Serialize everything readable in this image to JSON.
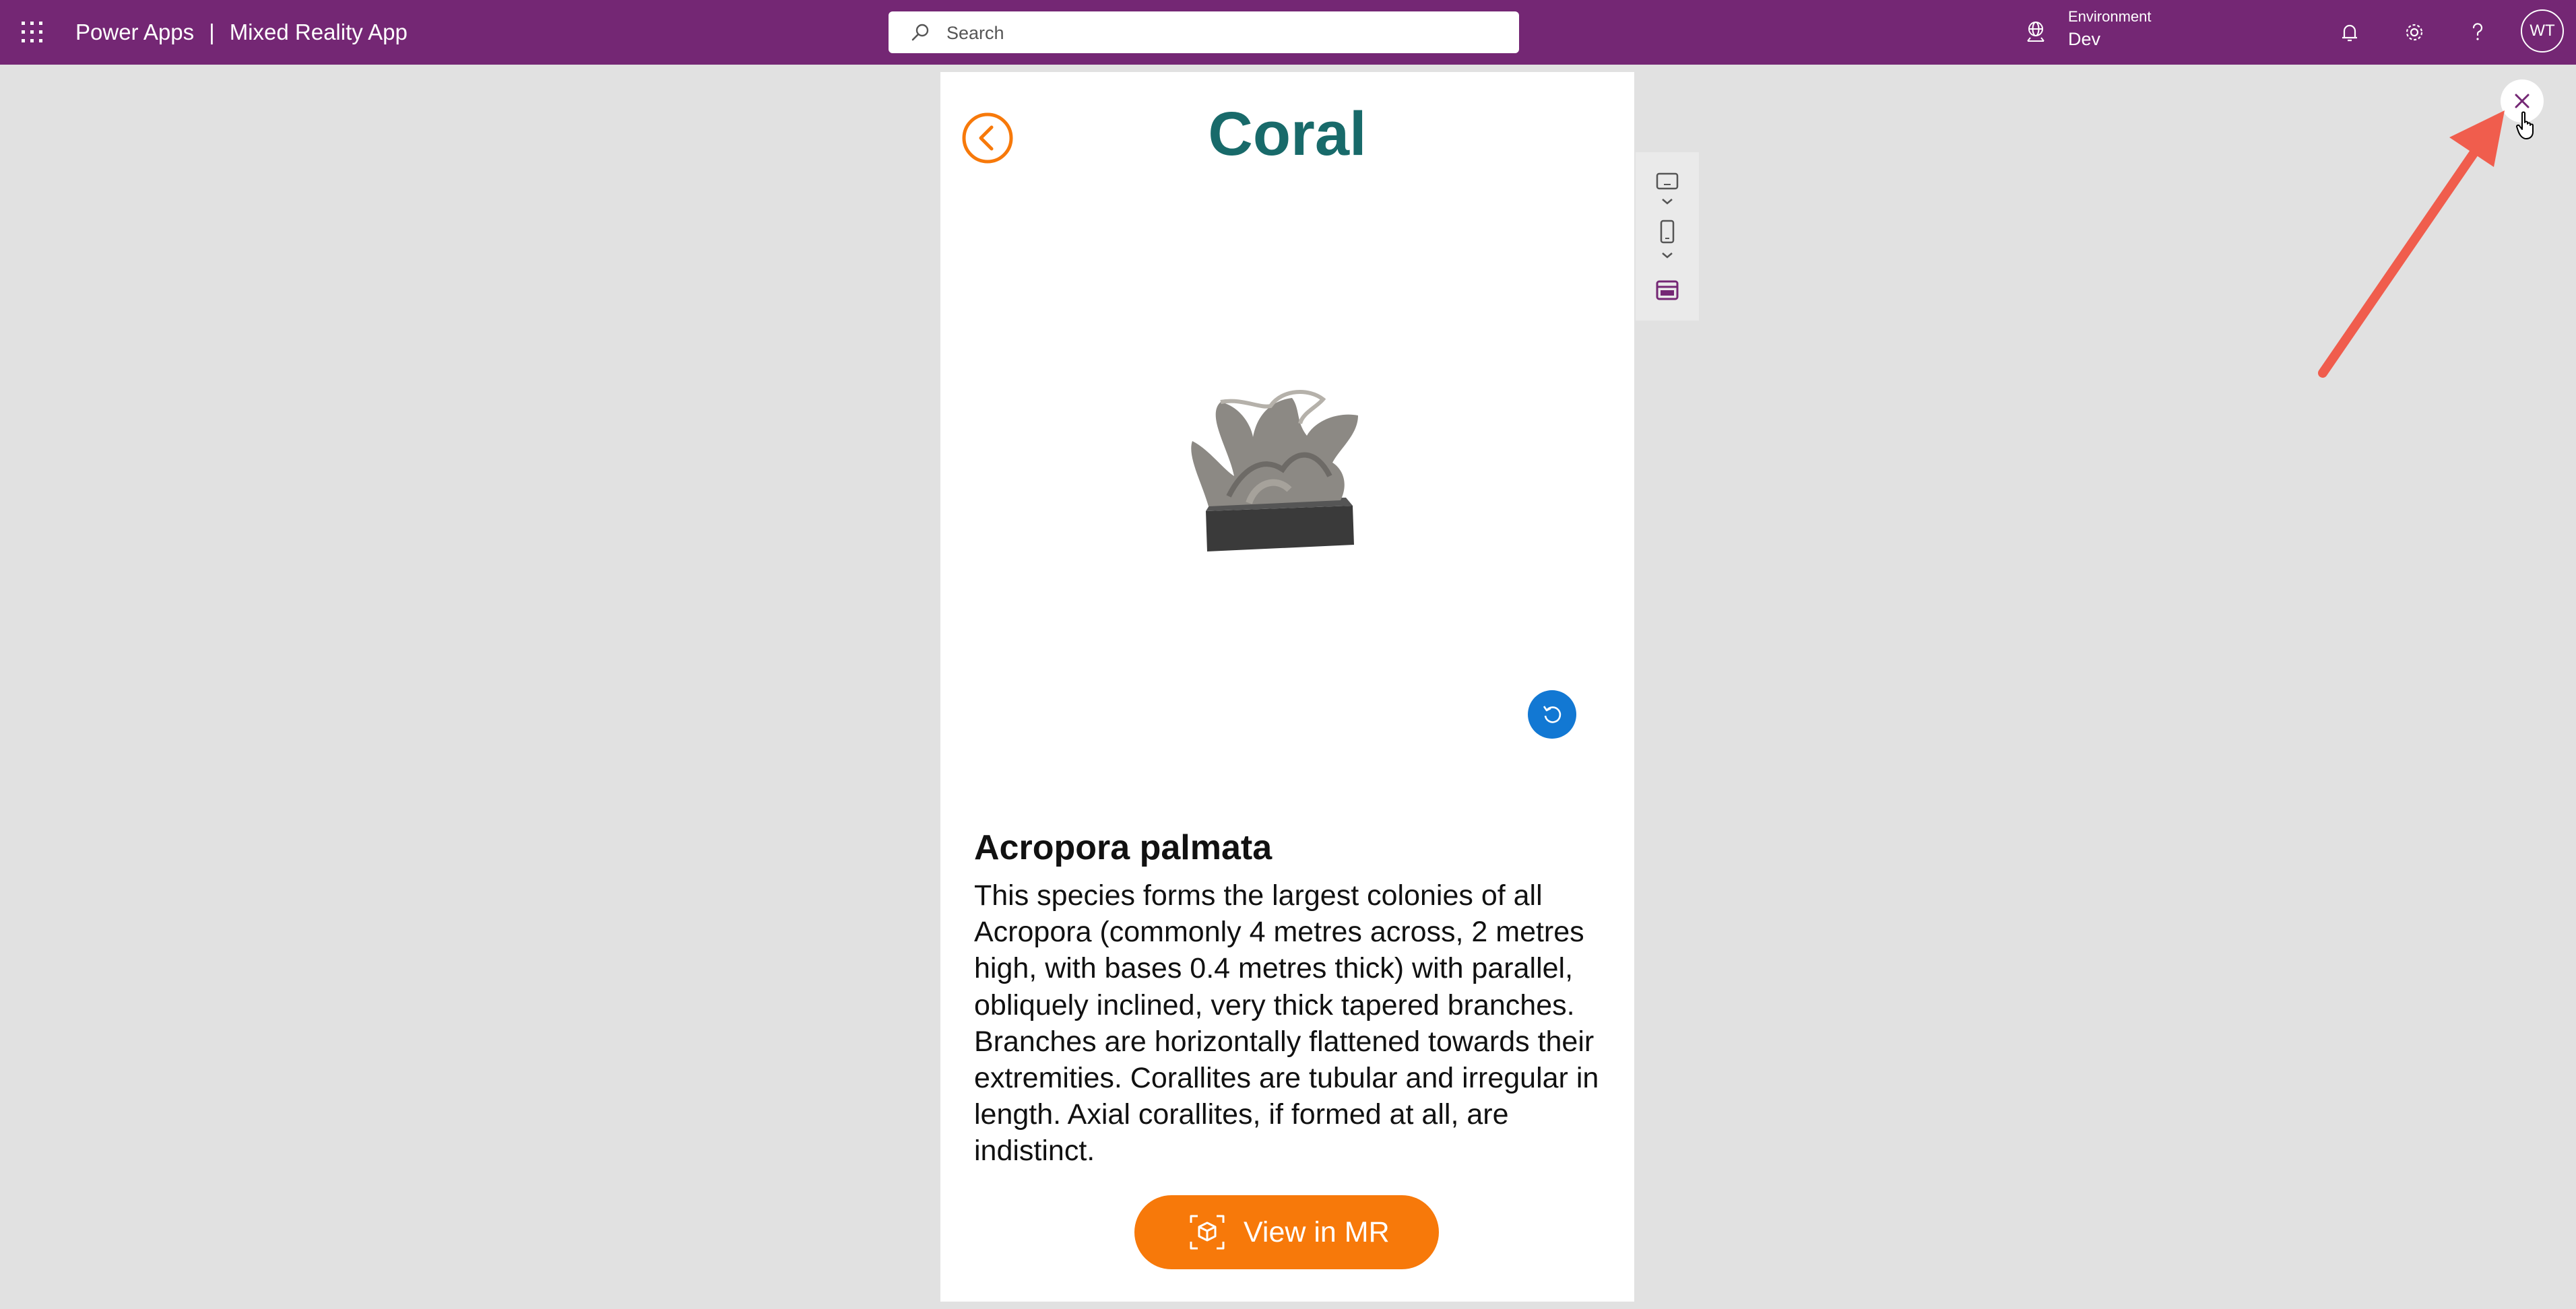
{
  "topbar": {
    "app_name": "Power Apps",
    "separator": "|",
    "app_title": "Mixed Reality App",
    "search_placeholder": "Search",
    "environment_label": "Environment",
    "environment_value": "Dev",
    "avatar_initials": "WT",
    "bg_color": "#742774"
  },
  "screen": {
    "title": "Coral",
    "species_name": "Acropora palmata",
    "description": "This species forms the largest colonies of all Acropora (commonly 4 metres across, 2 metres high, with bases 0.4 metres thick) with parallel, obliquely inclined, very thick tapered branches. Branches are horizontally flattened towards their extremities. Corallites are tubular and irregular in length. Axial corallites, if formed at all, are indistinct.",
    "view_mr_label": "View in MR",
    "title_color": "#186a6a",
    "accent_color": "#f7790a",
    "reset_button_color": "#1278d3"
  },
  "icons": {
    "waffle": "app-launcher-icon",
    "search": "search-icon",
    "environment": "environment-globe-icon",
    "notifications": "bell-icon",
    "settings": "gear-icon",
    "help": "question-icon",
    "back": "back-arrow-icon",
    "reset": "reset-view-icon",
    "mr": "mixed-reality-cube-icon",
    "close": "close-icon"
  }
}
